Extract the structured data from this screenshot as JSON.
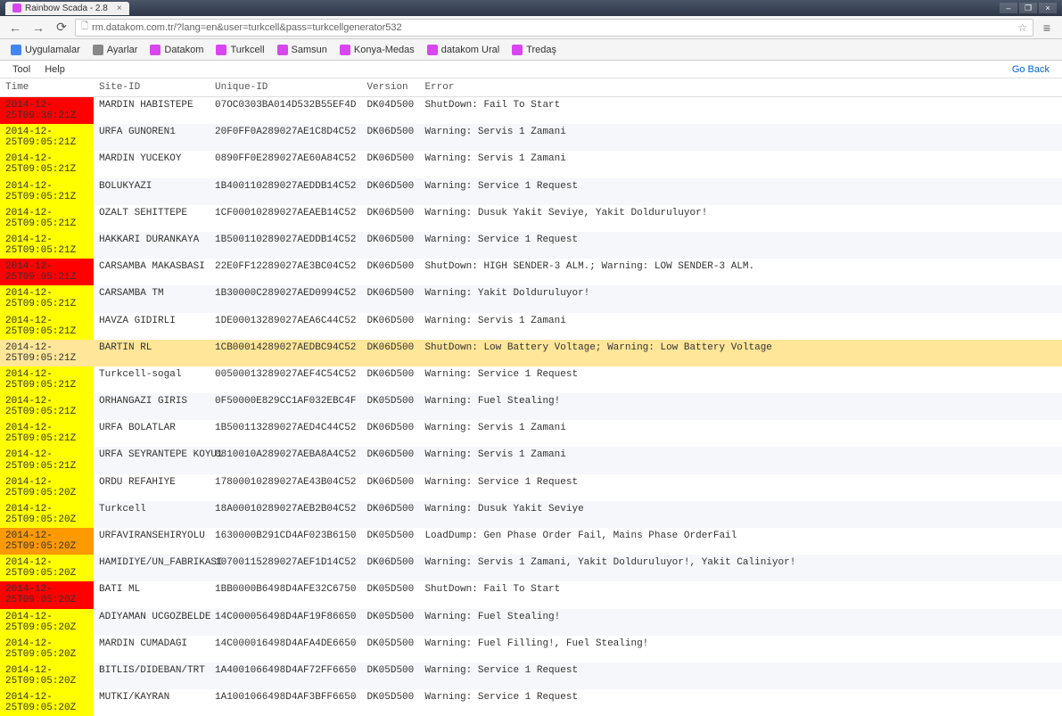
{
  "browser": {
    "tab_title": "Rainbow Scada - 2.8",
    "url": "rm.datakom.com.tr/?lang=en&user=turkcell&pass=turkcellgenerator532"
  },
  "bookmarks": [
    {
      "label": "Uygulamalar",
      "icon": "apps"
    },
    {
      "label": "Ayarlar",
      "icon": "gear"
    },
    {
      "label": "Datakom",
      "icon": "pink"
    },
    {
      "label": "Turkcell",
      "icon": "pink"
    },
    {
      "label": "Samsun",
      "icon": "pink"
    },
    {
      "label": "Konya-Medas",
      "icon": "pink"
    },
    {
      "label": "datakom Ural",
      "icon": "pink"
    },
    {
      "label": "Tredaş",
      "icon": "pink"
    }
  ],
  "menubar": {
    "tool": "Tool",
    "help": "Help",
    "goback": "Go Back"
  },
  "columns": {
    "time": "Time",
    "site": "Site-ID",
    "unique": "Unique-ID",
    "version": "Version",
    "error": "Error"
  },
  "rows": [
    {
      "time": "2014-12-25T09:36:21Z",
      "timeClass": "red",
      "site": "MARDIN HABISTEPE",
      "unique": "07OC0303BA014D532B55EF4D",
      "version": "DK04D500",
      "error": "ShutDown: Fail To Start"
    },
    {
      "time": "2014-12-25T09:05:21Z",
      "timeClass": "yellow",
      "site": "URFA GUNOREN1",
      "unique": "20F0FF0A289027AE1C8D4C52",
      "version": "DK06D500",
      "error": "Warning: Servis 1 Zamani"
    },
    {
      "time": "2014-12-25T09:05:21Z",
      "timeClass": "yellow",
      "site": "MARDIN YUCEKOY",
      "unique": "0890FF0E289027AE60A84C52",
      "version": "DK06D500",
      "error": "Warning: Servis 1 Zamani"
    },
    {
      "time": "2014-12-25T09:05:21Z",
      "timeClass": "yellow",
      "site": "BOLUKYAZI",
      "unique": "1B400110289027AEDDB14C52",
      "version": "DK06D500",
      "error": "Warning: Service 1 Request"
    },
    {
      "time": "2014-12-25T09:05:21Z",
      "timeClass": "yellow",
      "site": "OZALT SEHITTEPE",
      "unique": "1CF00010289027AEAEB14C52",
      "version": "DK06D500",
      "error": "Warning: Dusuk Yakit Seviye, Yakit Dolduruluyor!"
    },
    {
      "time": "2014-12-25T09:05:21Z",
      "timeClass": "yellow",
      "site": "HAKKARI DURANKAYA",
      "unique": "1B500110289027AEDDB14C52",
      "version": "DK06D500",
      "error": "Warning: Service 1 Request"
    },
    {
      "time": "2014-12-25T09:05:21Z",
      "timeClass": "red",
      "site": "CARSAMBA MAKASBASI",
      "unique": "22E0FF12289027AE3BC04C52",
      "version": "DK06D500",
      "error": "ShutDown: HIGH SENDER-3 ALM.; Warning: LOW SENDER-3 ALM."
    },
    {
      "time": "2014-12-25T09:05:21Z",
      "timeClass": "yellow",
      "site": "CARSAMBA TM",
      "unique": "1B30000C289027AED0994C52",
      "version": "DK06D500",
      "error": "Warning: Yakit Dolduruluyor!"
    },
    {
      "time": "2014-12-25T09:05:21Z",
      "timeClass": "yellow",
      "site": "HAVZA GIDIRLI",
      "unique": "1DE00013289027AEA6C44C52",
      "version": "DK06D500",
      "error": "Warning: Servis 1 Zamani"
    },
    {
      "time": "2014-12-25T09:05:21Z",
      "timeClass": "red",
      "site": "BARTIN RL",
      "unique": "1CB00014289027AEDBC94C52",
      "version": "DK06D500",
      "error": "ShutDown: Low Battery Voltage; Warning: Low Battery Voltage",
      "highlight": true
    },
    {
      "time": "2014-12-25T09:05:21Z",
      "timeClass": "yellow",
      "site": "Turkcell-sogal",
      "unique": "00500013289027AEF4C54C52",
      "version": "DK06D500",
      "error": "Warning: Service 1 Request"
    },
    {
      "time": "2014-12-25T09:05:21Z",
      "timeClass": "yellow",
      "site": "ORHANGAZI GIRIS",
      "unique": "0F50000E829CC1AF032EBC4F",
      "version": "DK05D500",
      "error": "Warning: Fuel Stealing!"
    },
    {
      "time": "2014-12-25T09:05:21Z",
      "timeClass": "yellow",
      "site": "URFA BOLATLAR",
      "unique": "1B500113289027AED4C44C52",
      "version": "DK06D500",
      "error": "Warning: Servis 1 Zamani"
    },
    {
      "time": "2014-12-25T09:05:21Z",
      "timeClass": "yellow",
      "site": "URFA SEYRANTEPE KOYU1",
      "unique": "0810010A289027AEBA8A4C52",
      "version": "DK06D500",
      "error": "Warning: Servis 1 Zamani"
    },
    {
      "time": "2014-12-25T09:05:20Z",
      "timeClass": "yellow",
      "site": "ORDU REFAHIYE",
      "unique": "17800010289027AE43B04C52",
      "version": "DK06D500",
      "error": "Warning: Service 1 Request"
    },
    {
      "time": "2014-12-25T09:05:20Z",
      "timeClass": "yellow",
      "site": "Turkcell",
      "unique": "18A00010289027AEB2B04C52",
      "version": "DK06D500",
      "error": "Warning: Dusuk Yakit Seviye"
    },
    {
      "time": "2014-12-25T09:05:20Z",
      "timeClass": "orange",
      "site": "URFAVIRANSEHIRYOLU",
      "unique": "1630000B291CD4AF023B6150",
      "version": "DK05D500",
      "error": "LoadDump: Gen Phase Order Fail, Mains Phase OrderFail"
    },
    {
      "time": "2014-12-25T09:05:20Z",
      "timeClass": "yellow",
      "site": "HAMIDIYE/UN_FABRIKASI",
      "unique": "10700115289027AEF1D14C52",
      "version": "DK06D500",
      "error": "Warning: Servis 1 Zamani, Yakit Dolduruluyor!, Yakit Caliniyor!"
    },
    {
      "time": "2014-12-25T09:05:20Z",
      "timeClass": "red",
      "site": "BATI ML",
      "unique": "1BB0000B6498D4AFE32C6750",
      "version": "DK05D500",
      "error": "ShutDown: Fail To Start"
    },
    {
      "time": "2014-12-25T09:05:20Z",
      "timeClass": "yellow",
      "site": "ADIYAMAN UCGOZBELDE",
      "unique": "14C000056498D4AF19F86650",
      "version": "DK05D500",
      "error": "Warning: Fuel Stealing!"
    },
    {
      "time": "2014-12-25T09:05:20Z",
      "timeClass": "yellow",
      "site": "MARDIN CUMADAGI",
      "unique": "14C000016498D4AFA4DE6650",
      "version": "DK05D500",
      "error": "Warning: Fuel Filling!, Fuel Stealing!"
    },
    {
      "time": "2014-12-25T09:05:20Z",
      "timeClass": "yellow",
      "site": "BITLIS/DIDEBAN/TRT",
      "unique": "1A4001066498D4AF72FF6650",
      "version": "DK05D500",
      "error": "Warning: Service 1 Request"
    },
    {
      "time": "2014-12-25T09:05:20Z",
      "timeClass": "yellow",
      "site": "MUTKI/KAYRAN",
      "unique": "1A1001066498D4AF3BFF6650",
      "version": "DK05D500",
      "error": "Warning: Service 1 Request"
    }
  ]
}
